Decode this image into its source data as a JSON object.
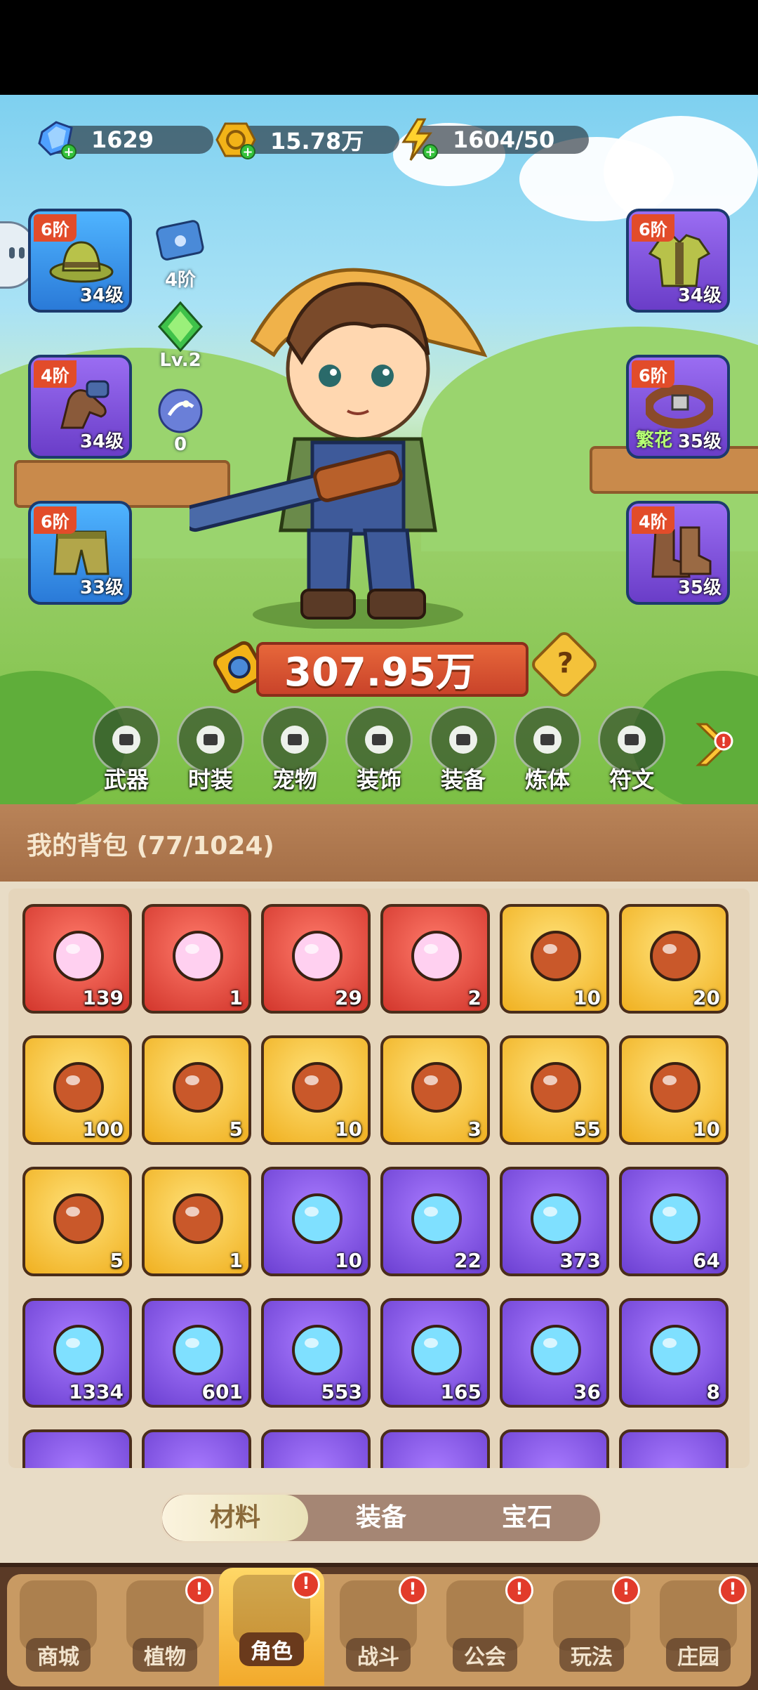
{
  "resources": {
    "diamond": "1629",
    "gold": "15.78万",
    "energy": "1604/50"
  },
  "equip_left": [
    {
      "tier": "6阶",
      "level": "34级",
      "color": "blue",
      "icon": "hat-icon"
    },
    {
      "tier": "4阶",
      "level": "34级",
      "color": "purple",
      "icon": "gloves-icon"
    },
    {
      "tier": "6阶",
      "level": "33级",
      "color": "blue",
      "icon": "pants-icon"
    }
  ],
  "equip_right": [
    {
      "tier": "6阶",
      "level": "34级",
      "color": "purple",
      "icon": "shirt-icon"
    },
    {
      "tier": "6阶",
      "level": "35级",
      "tag": "繁花",
      "color": "purple",
      "icon": "belt-icon"
    },
    {
      "tier": "4阶",
      "level": "35级",
      "color": "purple",
      "icon": "boots-icon"
    }
  ],
  "mini": {
    "scroll_tier": "4阶",
    "gem_level": "Lv.2",
    "orb_count": "0"
  },
  "power": "307.95万",
  "help_symbol": "?",
  "categories": [
    "武器",
    "时装",
    "宠物",
    "装饰",
    "装备",
    "炼体",
    "符文"
  ],
  "bag_title": "我的背包 (77/1024)",
  "items": [
    {
      "q": "139",
      "c": "red",
      "icon": "star-crystal-icon"
    },
    {
      "q": "1",
      "c": "red",
      "icon": "moon-crystal-icon"
    },
    {
      "q": "29",
      "c": "red",
      "icon": "red-potion-icon"
    },
    {
      "q": "2",
      "c": "red",
      "icon": "green-vial-icon"
    },
    {
      "q": "10",
      "c": "gold",
      "icon": "skull-scroll-icon"
    },
    {
      "q": "20",
      "c": "gold",
      "icon": "rune-stone-icon"
    },
    {
      "q": "100",
      "c": "gold",
      "icon": "orange-potion-icon"
    },
    {
      "q": "5",
      "c": "gold",
      "icon": "gold-ore-icon"
    },
    {
      "q": "10",
      "c": "gold",
      "icon": "red-flower-icon"
    },
    {
      "q": "3",
      "c": "gold",
      "icon": "flower-pot-icon"
    },
    {
      "q": "55",
      "c": "gold",
      "icon": "spell-book-icon"
    },
    {
      "q": "10",
      "c": "gold",
      "icon": "jar-icon"
    },
    {
      "q": "5",
      "c": "gold",
      "icon": "owl-puzzle-icon"
    },
    {
      "q": "1",
      "c": "gold",
      "icon": "golden-flower-icon"
    },
    {
      "q": "10",
      "c": "purple",
      "icon": "purple-potion-icon"
    },
    {
      "q": "22",
      "c": "purple",
      "icon": "blue-leaf-icon"
    },
    {
      "q": "373",
      "c": "purple",
      "icon": "green-scroll-icon"
    },
    {
      "q": "64",
      "c": "purple",
      "icon": "purple-scroll-icon"
    },
    {
      "q": "1334",
      "c": "purple",
      "icon": "blue-scroll-icon"
    },
    {
      "q": "601",
      "c": "purple",
      "icon": "fire-scroll-icon"
    },
    {
      "q": "553",
      "c": "purple",
      "icon": "lightning-scroll-icon"
    },
    {
      "q": "165",
      "c": "purple",
      "icon": "violet-potion-icon"
    },
    {
      "q": "36",
      "c": "purple",
      "icon": "blue-bud-icon"
    },
    {
      "q": "8",
      "c": "purple",
      "icon": "purple-bud-icon"
    }
  ],
  "tabs": [
    "材料",
    "装备",
    "宝石"
  ],
  "active_tab": "材料",
  "nav": [
    "商城",
    "植物",
    "角色",
    "战斗",
    "公会",
    "玩法",
    "庄园"
  ],
  "active_nav": "角色",
  "alert_symbol": "!"
}
